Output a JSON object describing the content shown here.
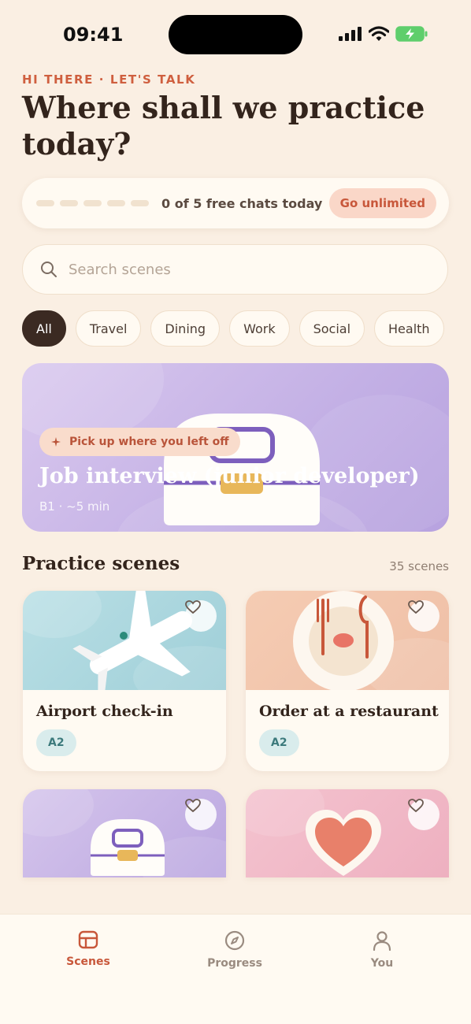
{
  "status_bar": {
    "time": "09:41"
  },
  "header": {
    "eyebrow": "HI THERE · LET'S TALK",
    "title": "Where shall we practice today?"
  },
  "quota": {
    "used": 0,
    "total": 5,
    "text": "0 of 5 free chats today",
    "cta_label": "Go unlimited"
  },
  "search": {
    "placeholder": "Search scenes",
    "value": ""
  },
  "filters": {
    "selected": "All",
    "items": [
      "All",
      "Travel",
      "Dining",
      "Work",
      "Social",
      "Health"
    ]
  },
  "hero": {
    "pill_label": "Pick up where you left off",
    "title": "Job interview (junior developer)",
    "meta": "B1 · ~5 min",
    "icon": "briefcase-icon"
  },
  "scenes": {
    "title": "Practice scenes",
    "count_label": "35 scenes",
    "cards": [
      {
        "title": "Airport check-in",
        "level": "A2",
        "icon": "airplane-icon"
      },
      {
        "title": "Order at a restaurant",
        "level": "A2",
        "icon": "plate-cutlery-icon"
      },
      {
        "title": "",
        "level": "",
        "icon": "briefcase-icon"
      },
      {
        "title": "",
        "level": "",
        "icon": "heart-icon"
      }
    ]
  },
  "tab_bar": {
    "items": [
      {
        "label": "Scenes",
        "icon": "scenes-icon",
        "active": true
      },
      {
        "label": "Progress",
        "icon": "compass-icon",
        "active": false
      },
      {
        "label": "You",
        "icon": "person-icon",
        "active": false
      }
    ]
  },
  "colors": {
    "background": "#faefe3",
    "accent": "#c8573a",
    "hero_purple": "#c3b0e5",
    "level_badge": "#d9ecec"
  }
}
